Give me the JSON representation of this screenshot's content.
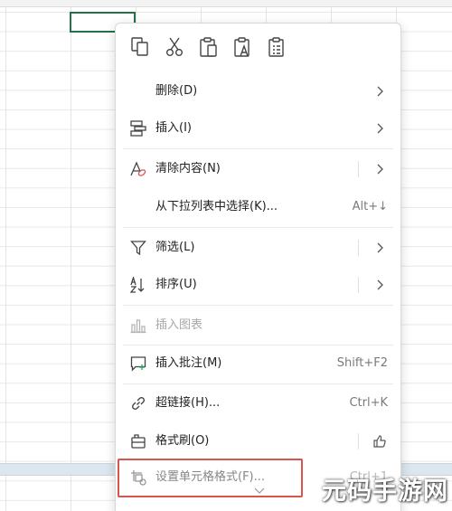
{
  "context_menu": {
    "quick_actions": [
      {
        "name": "copy-icon"
      },
      {
        "name": "cut-icon"
      },
      {
        "name": "paste-icon"
      },
      {
        "name": "paste-values-icon"
      },
      {
        "name": "paste-special-icon"
      }
    ],
    "items": {
      "delete": {
        "label": "删除(D)"
      },
      "insert": {
        "label": "插入(I)"
      },
      "clear_contents": {
        "label": "清除内容(N)"
      },
      "pick_from_list": {
        "label": "从下拉列表中选择(K)...",
        "shortcut": "Alt+↓"
      },
      "filter": {
        "label": "筛选(L)"
      },
      "sort": {
        "label": "排序(U)"
      },
      "insert_chart": {
        "label": "插入图表"
      },
      "insert_comment": {
        "label": "插入批注(M)",
        "shortcut": "Shift+F2"
      },
      "hyperlink": {
        "label": "超链接(H)...",
        "shortcut": "Ctrl+K"
      },
      "format_painter": {
        "label": "格式刷(O)"
      },
      "format_cells": {
        "label": "设置单元格格式(F)...",
        "shortcut": "Ctrl+1"
      }
    }
  },
  "watermark": {
    "text": "元码手游网"
  },
  "colors": {
    "active_cell_border": "#217346",
    "highlight_box": "#d9534f",
    "icon_stroke": "#444444",
    "comment_plus": "#2e9e5b",
    "clear_accent": "#d9534f"
  }
}
